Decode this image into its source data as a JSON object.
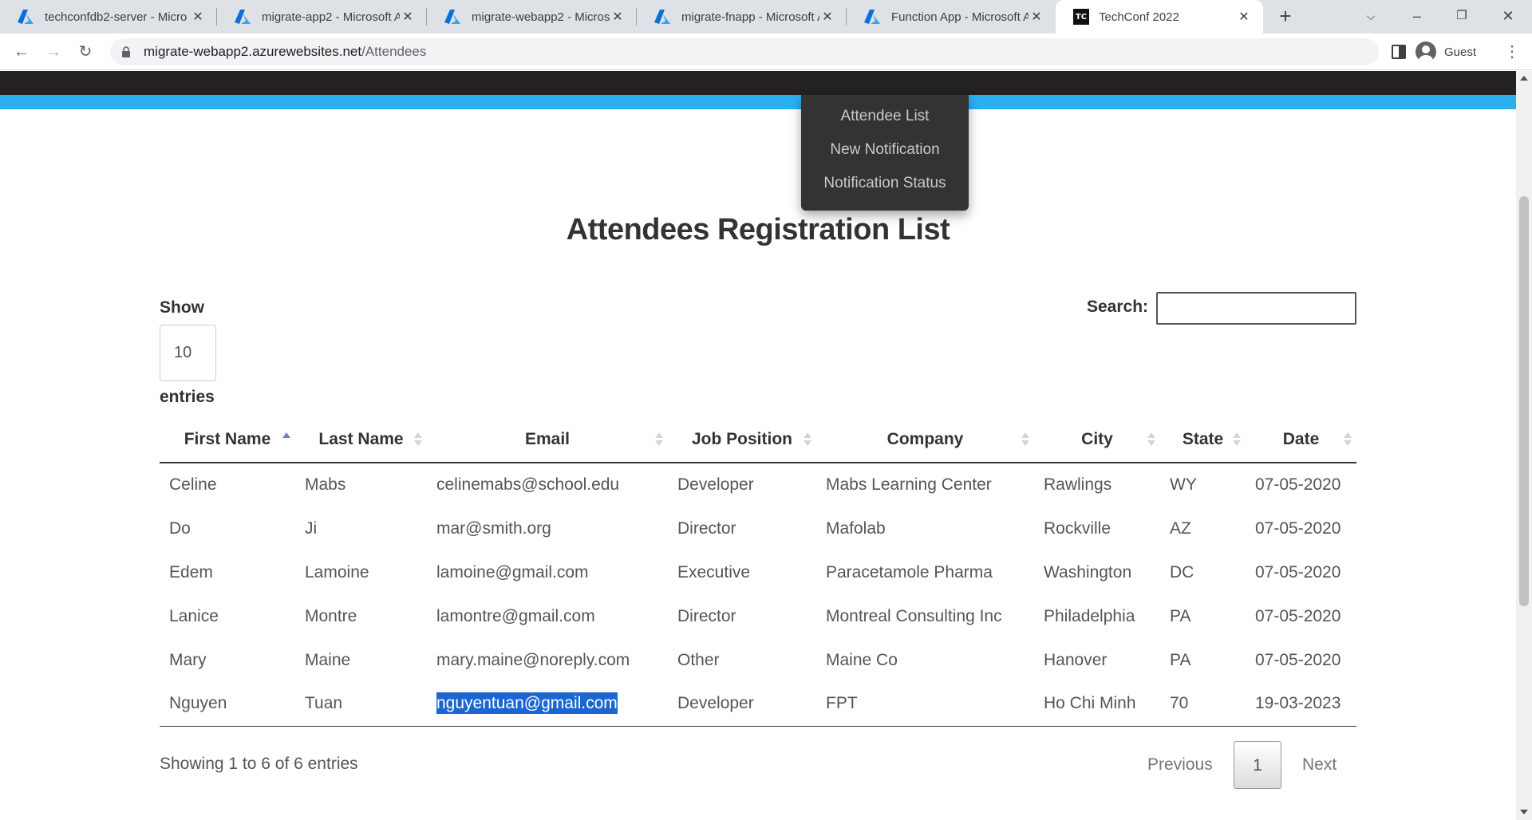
{
  "browser": {
    "tabs": [
      {
        "title": "techconfdb2-server - Micro",
        "icon": "azure-icon"
      },
      {
        "title": "migrate-app2 - Microsoft A",
        "icon": "azure-icon"
      },
      {
        "title": "migrate-webapp2 - Microso",
        "icon": "azure-icon"
      },
      {
        "title": "migrate-fnapp - Microsoft A",
        "icon": "azure-icon"
      },
      {
        "title": "Function App - Microsoft A",
        "icon": "azure-icon"
      },
      {
        "title": "TechConf 2022",
        "icon": "techconf-favicon",
        "active": true
      }
    ],
    "favicon_text": "TC",
    "new_tab": "+",
    "url_host": "migrate-webapp2.azurewebsites.net",
    "url_path": "/Attendees",
    "profile": "Guest"
  },
  "nav": {
    "dropdown": [
      "Attendee List",
      "New Notification",
      "Notification Status"
    ]
  },
  "page": {
    "title": "Attendees Registration List",
    "length_show": "Show",
    "length_value": "10",
    "length_entries": "entries",
    "search_label": "Search:",
    "search_value": ""
  },
  "table": {
    "columns": [
      "First Name",
      "Last Name",
      "Email",
      "Job Position",
      "Company",
      "City",
      "State",
      "Date"
    ],
    "sorted_column": "First Name",
    "sort_direction": "asc",
    "rows": [
      [
        "Celine",
        "Mabs",
        "celinemabs@school.edu",
        "Developer",
        "Mabs Learning Center",
        "Rawlings",
        "WY",
        "07-05-2020"
      ],
      [
        "Do",
        "Ji",
        "mar@smith.org",
        "Director",
        "Mafolab",
        "Rockville",
        "AZ",
        "07-05-2020"
      ],
      [
        "Edem",
        "Lamoine",
        "lamoine@gmail.com",
        "Executive",
        "Paracetamole Pharma",
        "Washington",
        "DC",
        "07-05-2020"
      ],
      [
        "Lanice",
        "Montre",
        "lamontre@gmail.com",
        "Director",
        "Montreal Consulting Inc",
        "Philadelphia",
        "PA",
        "07-05-2020"
      ],
      [
        "Mary",
        "Maine",
        "mary.maine@noreply.com",
        "Other",
        "Maine Co",
        "Hanover",
        "PA",
        "07-05-2020"
      ],
      [
        "Nguyen",
        "Tuan",
        "nguyentuan@gmail.com",
        "Developer",
        "FPT",
        "Ho Chi Minh",
        "70",
        "19-03-2023"
      ]
    ],
    "selected_cell": "nguyentuan@gmail.com"
  },
  "footer": {
    "info": "Showing 1 to 6 of 6 entries",
    "previous": "Previous",
    "current_page": "1",
    "next": "Next"
  },
  "colors": {
    "navbar": "#222222",
    "accent_band": "#2bb0ee",
    "dropdown_bg": "#333333",
    "selection": "#1a66d2",
    "sort_active": "#6a7fd6"
  }
}
